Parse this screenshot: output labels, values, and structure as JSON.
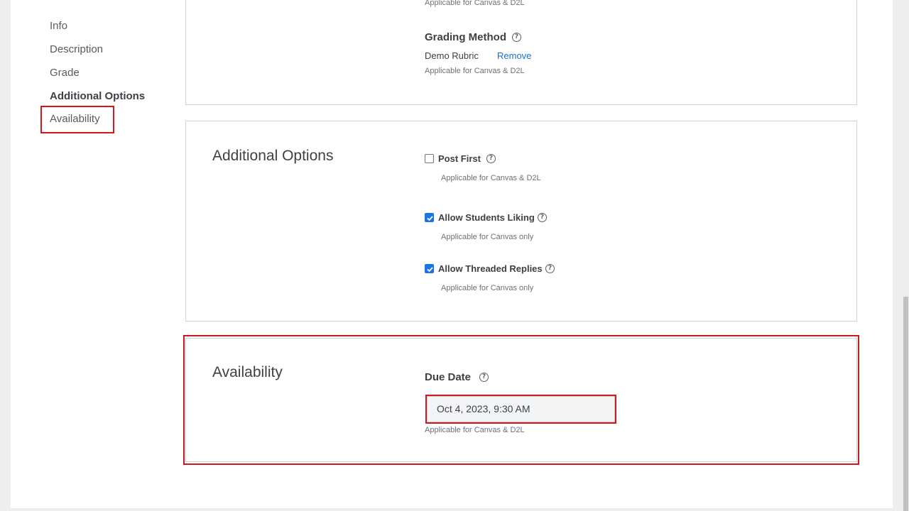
{
  "nav": {
    "items": [
      {
        "label": "Info"
      },
      {
        "label": "Description"
      },
      {
        "label": "Grade"
      },
      {
        "label": "Additional Options"
      },
      {
        "label": "Availability"
      }
    ],
    "active": "Additional Options"
  },
  "grade_section": {
    "top_hint": "Applicable for Canvas & D2L",
    "grading_method_label": "Grading Method",
    "rubric_name": "Demo Rubric",
    "remove_label": "Remove",
    "hint": "Applicable for Canvas & D2L"
  },
  "additional_options": {
    "title": "Additional Options",
    "options": [
      {
        "label": "Post First",
        "checked": false,
        "hint": "Applicable for Canvas & D2L"
      },
      {
        "label": "Allow Students Liking",
        "checked": true,
        "hint": "Applicable for Canvas only"
      },
      {
        "label": "Allow Threaded Replies",
        "checked": true,
        "hint": "Applicable for Canvas only"
      }
    ]
  },
  "availability": {
    "title": "Availability",
    "due_date_label": "Due Date",
    "due_date_value": "Oct 4, 2023, 9:30 AM",
    "hint": "Applicable for Canvas & D2L"
  },
  "colors": {
    "highlight": "#d3161b",
    "link": "#1a73c9",
    "checkbox_checked": "#1a73e8"
  },
  "icons": {
    "help": "help-circle-icon",
    "check": "checkmark-icon"
  }
}
